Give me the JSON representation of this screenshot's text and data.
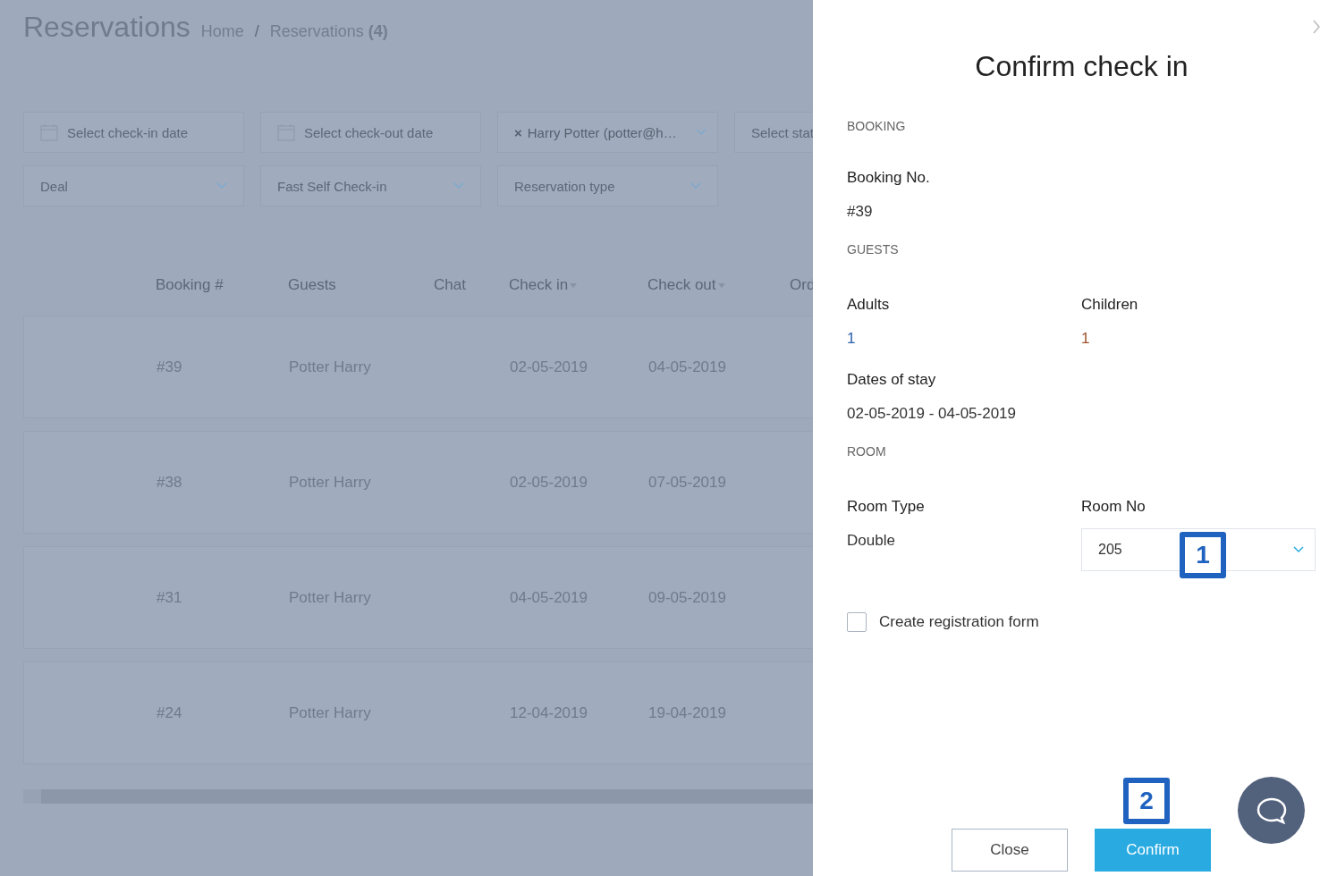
{
  "page": {
    "title": "Reservations",
    "breadcrumb": [
      {
        "label": "Home"
      },
      {
        "label": "Reservations",
        "count": "(4)"
      }
    ],
    "separator": "/"
  },
  "filters": [
    {
      "kind": "date",
      "placeholder": "Select check-in date"
    },
    {
      "kind": "date",
      "placeholder": "Select check-out date"
    },
    {
      "kind": "tag",
      "remove": "×",
      "value": "Harry Potter (potter@h…"
    },
    {
      "kind": "text",
      "placeholder": "Select stat"
    },
    {
      "kind": "select",
      "placeholder": "Deal"
    },
    {
      "kind": "select",
      "placeholder": "Fast Self Check-in"
    },
    {
      "kind": "select",
      "placeholder": "Reservation type"
    }
  ],
  "table": {
    "columns": [
      {
        "label": "Booking #",
        "sortable": false
      },
      {
        "label": "Guests",
        "sortable": false
      },
      {
        "label": "Chat",
        "sortable": false
      },
      {
        "label": "Check in",
        "sortable": true
      },
      {
        "label": "Check out",
        "sortable": true
      },
      {
        "label": "Ord",
        "sortable": false
      }
    ],
    "rows": [
      {
        "booking": "#39",
        "guest": "Potter Harry",
        "check_in": "02-05-2019",
        "check_out": "04-05-2019"
      },
      {
        "booking": "#38",
        "guest": "Potter Harry",
        "check_in": "02-05-2019",
        "check_out": "07-05-2019"
      },
      {
        "booking": "#31",
        "guest": "Potter Harry",
        "check_in": "04-05-2019",
        "check_out": "09-05-2019"
      },
      {
        "booking": "#24",
        "guest": "Potter Harry",
        "check_in": "12-04-2019",
        "check_out": "19-04-2019"
      }
    ]
  },
  "dialog": {
    "title": "Confirm check in",
    "booking_section": "BOOKING",
    "booking_label": "Booking No.",
    "booking_value": "#39",
    "guests_section": "GUESTS",
    "adults_label": "Adults",
    "adults_value": "1",
    "children_label": "Children",
    "children_value": "1",
    "dates_label": "Dates of stay",
    "dates_value": "02-05-2019 - 04-05-2019",
    "room_section": "ROOM",
    "room_type_label": "Room Type",
    "room_type_value": "Double",
    "room_no_label": "Room No",
    "room_no_value": "205",
    "checkbox": {
      "label": "Create registration form",
      "checked": false
    },
    "buttons": [
      {
        "label": "Close",
        "kind": "secondary"
      },
      {
        "label": "Confirm",
        "kind": "primary"
      }
    ]
  },
  "annotations": [
    "1",
    "2"
  ]
}
